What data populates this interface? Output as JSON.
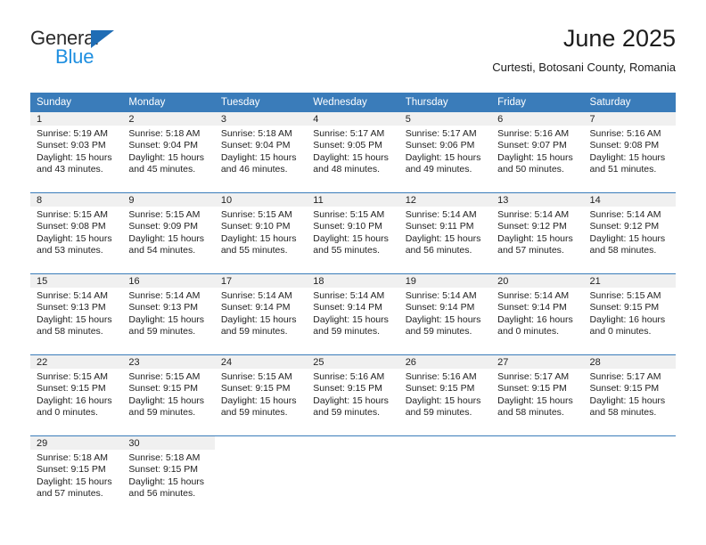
{
  "brand": {
    "word_one": "General",
    "word_two": "Blue",
    "triangle_icon": "brand-triangle-icon",
    "color_dark": "#2b2b2b",
    "color_blue": "#1f8fe0",
    "color_triangle": "#1f6db5"
  },
  "header": {
    "month_title": "June 2025",
    "location": "Curtesti, Botosani County, Romania"
  },
  "colors": {
    "header_blue": "#3a7cba",
    "daynum_band": "#f0f0f0",
    "text": "#222222",
    "page_background": "#ffffff"
  },
  "calendar": {
    "weekday_headers": [
      "Sunday",
      "Monday",
      "Tuesday",
      "Wednesday",
      "Thursday",
      "Friday",
      "Saturday"
    ],
    "weeks": [
      [
        {
          "day": "1",
          "sunrise": "Sunrise: 5:19 AM",
          "sunset": "Sunset: 9:03 PM",
          "daylight_line1": "Daylight: 15 hours",
          "daylight_line2": "and 43 minutes."
        },
        {
          "day": "2",
          "sunrise": "Sunrise: 5:18 AM",
          "sunset": "Sunset: 9:04 PM",
          "daylight_line1": "Daylight: 15 hours",
          "daylight_line2": "and 45 minutes."
        },
        {
          "day": "3",
          "sunrise": "Sunrise: 5:18 AM",
          "sunset": "Sunset: 9:04 PM",
          "daylight_line1": "Daylight: 15 hours",
          "daylight_line2": "and 46 minutes."
        },
        {
          "day": "4",
          "sunrise": "Sunrise: 5:17 AM",
          "sunset": "Sunset: 9:05 PM",
          "daylight_line1": "Daylight: 15 hours",
          "daylight_line2": "and 48 minutes."
        },
        {
          "day": "5",
          "sunrise": "Sunrise: 5:17 AM",
          "sunset": "Sunset: 9:06 PM",
          "daylight_line1": "Daylight: 15 hours",
          "daylight_line2": "and 49 minutes."
        },
        {
          "day": "6",
          "sunrise": "Sunrise: 5:16 AM",
          "sunset": "Sunset: 9:07 PM",
          "daylight_line1": "Daylight: 15 hours",
          "daylight_line2": "and 50 minutes."
        },
        {
          "day": "7",
          "sunrise": "Sunrise: 5:16 AM",
          "sunset": "Sunset: 9:08 PM",
          "daylight_line1": "Daylight: 15 hours",
          "daylight_line2": "and 51 minutes."
        }
      ],
      [
        {
          "day": "8",
          "sunrise": "Sunrise: 5:15 AM",
          "sunset": "Sunset: 9:08 PM",
          "daylight_line1": "Daylight: 15 hours",
          "daylight_line2": "and 53 minutes."
        },
        {
          "day": "9",
          "sunrise": "Sunrise: 5:15 AM",
          "sunset": "Sunset: 9:09 PM",
          "daylight_line1": "Daylight: 15 hours",
          "daylight_line2": "and 54 minutes."
        },
        {
          "day": "10",
          "sunrise": "Sunrise: 5:15 AM",
          "sunset": "Sunset: 9:10 PM",
          "daylight_line1": "Daylight: 15 hours",
          "daylight_line2": "and 55 minutes."
        },
        {
          "day": "11",
          "sunrise": "Sunrise: 5:15 AM",
          "sunset": "Sunset: 9:10 PM",
          "daylight_line1": "Daylight: 15 hours",
          "daylight_line2": "and 55 minutes."
        },
        {
          "day": "12",
          "sunrise": "Sunrise: 5:14 AM",
          "sunset": "Sunset: 9:11 PM",
          "daylight_line1": "Daylight: 15 hours",
          "daylight_line2": "and 56 minutes."
        },
        {
          "day": "13",
          "sunrise": "Sunrise: 5:14 AM",
          "sunset": "Sunset: 9:12 PM",
          "daylight_line1": "Daylight: 15 hours",
          "daylight_line2": "and 57 minutes."
        },
        {
          "day": "14",
          "sunrise": "Sunrise: 5:14 AM",
          "sunset": "Sunset: 9:12 PM",
          "daylight_line1": "Daylight: 15 hours",
          "daylight_line2": "and 58 minutes."
        }
      ],
      [
        {
          "day": "15",
          "sunrise": "Sunrise: 5:14 AM",
          "sunset": "Sunset: 9:13 PM",
          "daylight_line1": "Daylight: 15 hours",
          "daylight_line2": "and 58 minutes."
        },
        {
          "day": "16",
          "sunrise": "Sunrise: 5:14 AM",
          "sunset": "Sunset: 9:13 PM",
          "daylight_line1": "Daylight: 15 hours",
          "daylight_line2": "and 59 minutes."
        },
        {
          "day": "17",
          "sunrise": "Sunrise: 5:14 AM",
          "sunset": "Sunset: 9:14 PM",
          "daylight_line1": "Daylight: 15 hours",
          "daylight_line2": "and 59 minutes."
        },
        {
          "day": "18",
          "sunrise": "Sunrise: 5:14 AM",
          "sunset": "Sunset: 9:14 PM",
          "daylight_line1": "Daylight: 15 hours",
          "daylight_line2": "and 59 minutes."
        },
        {
          "day": "19",
          "sunrise": "Sunrise: 5:14 AM",
          "sunset": "Sunset: 9:14 PM",
          "daylight_line1": "Daylight: 15 hours",
          "daylight_line2": "and 59 minutes."
        },
        {
          "day": "20",
          "sunrise": "Sunrise: 5:14 AM",
          "sunset": "Sunset: 9:14 PM",
          "daylight_line1": "Daylight: 16 hours",
          "daylight_line2": "and 0 minutes."
        },
        {
          "day": "21",
          "sunrise": "Sunrise: 5:15 AM",
          "sunset": "Sunset: 9:15 PM",
          "daylight_line1": "Daylight: 16 hours",
          "daylight_line2": "and 0 minutes."
        }
      ],
      [
        {
          "day": "22",
          "sunrise": "Sunrise: 5:15 AM",
          "sunset": "Sunset: 9:15 PM",
          "daylight_line1": "Daylight: 16 hours",
          "daylight_line2": "and 0 minutes."
        },
        {
          "day": "23",
          "sunrise": "Sunrise: 5:15 AM",
          "sunset": "Sunset: 9:15 PM",
          "daylight_line1": "Daylight: 15 hours",
          "daylight_line2": "and 59 minutes."
        },
        {
          "day": "24",
          "sunrise": "Sunrise: 5:15 AM",
          "sunset": "Sunset: 9:15 PM",
          "daylight_line1": "Daylight: 15 hours",
          "daylight_line2": "and 59 minutes."
        },
        {
          "day": "25",
          "sunrise": "Sunrise: 5:16 AM",
          "sunset": "Sunset: 9:15 PM",
          "daylight_line1": "Daylight: 15 hours",
          "daylight_line2": "and 59 minutes."
        },
        {
          "day": "26",
          "sunrise": "Sunrise: 5:16 AM",
          "sunset": "Sunset: 9:15 PM",
          "daylight_line1": "Daylight: 15 hours",
          "daylight_line2": "and 59 minutes."
        },
        {
          "day": "27",
          "sunrise": "Sunrise: 5:17 AM",
          "sunset": "Sunset: 9:15 PM",
          "daylight_line1": "Daylight: 15 hours",
          "daylight_line2": "and 58 minutes."
        },
        {
          "day": "28",
          "sunrise": "Sunrise: 5:17 AM",
          "sunset": "Sunset: 9:15 PM",
          "daylight_line1": "Daylight: 15 hours",
          "daylight_line2": "and 58 minutes."
        }
      ],
      [
        {
          "day": "29",
          "sunrise": "Sunrise: 5:18 AM",
          "sunset": "Sunset: 9:15 PM",
          "daylight_line1": "Daylight: 15 hours",
          "daylight_line2": "and 57 minutes."
        },
        {
          "day": "30",
          "sunrise": "Sunrise: 5:18 AM",
          "sunset": "Sunset: 9:15 PM",
          "daylight_line1": "Daylight: 15 hours",
          "daylight_line2": "and 56 minutes."
        },
        {
          "day": "",
          "sunrise": "",
          "sunset": "",
          "daylight_line1": "",
          "daylight_line2": ""
        },
        {
          "day": "",
          "sunrise": "",
          "sunset": "",
          "daylight_line1": "",
          "daylight_line2": ""
        },
        {
          "day": "",
          "sunrise": "",
          "sunset": "",
          "daylight_line1": "",
          "daylight_line2": ""
        },
        {
          "day": "",
          "sunrise": "",
          "sunset": "",
          "daylight_line1": "",
          "daylight_line2": ""
        },
        {
          "day": "",
          "sunrise": "",
          "sunset": "",
          "daylight_line1": "",
          "daylight_line2": ""
        }
      ]
    ]
  }
}
